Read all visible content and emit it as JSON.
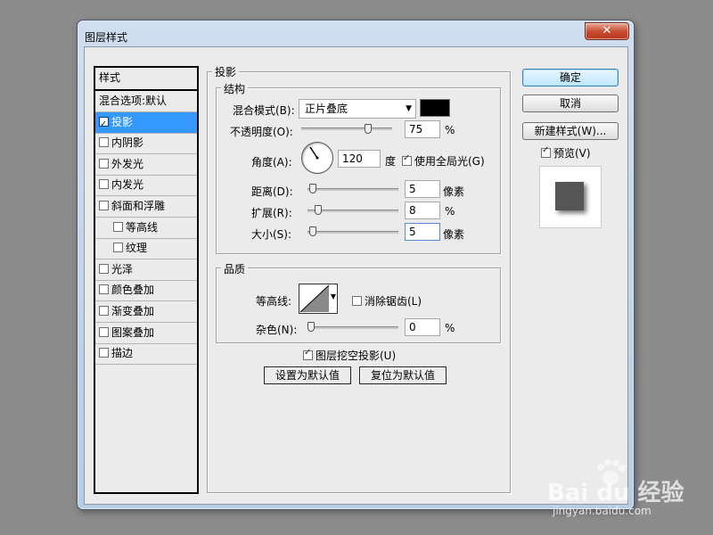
{
  "window": {
    "title": "图层样式",
    "close_glyph": "✕"
  },
  "style_list": {
    "header": "样式",
    "items": [
      {
        "label": "混合选项:默认",
        "checkbox": false,
        "checked": false,
        "indent": false,
        "selected": false
      },
      {
        "label": "投影",
        "checkbox": true,
        "checked": true,
        "indent": false,
        "selected": true
      },
      {
        "label": "内阴影",
        "checkbox": true,
        "checked": false,
        "indent": false,
        "selected": false
      },
      {
        "label": "外发光",
        "checkbox": true,
        "checked": false,
        "indent": false,
        "selected": false
      },
      {
        "label": "内发光",
        "checkbox": true,
        "checked": false,
        "indent": false,
        "selected": false
      },
      {
        "label": "斜面和浮雕",
        "checkbox": true,
        "checked": false,
        "indent": false,
        "selected": false
      },
      {
        "label": "等高线",
        "checkbox": true,
        "checked": false,
        "indent": true,
        "selected": false
      },
      {
        "label": "纹理",
        "checkbox": true,
        "checked": false,
        "indent": true,
        "selected": false
      },
      {
        "label": "光泽",
        "checkbox": true,
        "checked": false,
        "indent": false,
        "selected": false
      },
      {
        "label": "颜色叠加",
        "checkbox": true,
        "checked": false,
        "indent": false,
        "selected": false
      },
      {
        "label": "渐变叠加",
        "checkbox": true,
        "checked": false,
        "indent": false,
        "selected": false
      },
      {
        "label": "图案叠加",
        "checkbox": true,
        "checked": false,
        "indent": false,
        "selected": false
      },
      {
        "label": "描边",
        "checkbox": true,
        "checked": false,
        "indent": false,
        "selected": false
      }
    ]
  },
  "drop_shadow": {
    "section_title": "投影",
    "structure": {
      "title": "结构",
      "blend_mode_label": "混合模式(B):",
      "blend_mode_value": "正片叠底",
      "color": "#000000",
      "opacity_label": "不透明度(O):",
      "opacity_value": "75",
      "opacity_unit": "%",
      "opacity_level": 0.75,
      "angle_label": "角度(A):",
      "angle_value": "120",
      "angle_unit": "度",
      "global_light_label": "使用全局光(G)",
      "global_light_checked": true,
      "distance_label": "距离(D):",
      "distance_value": "5",
      "distance_unit": "像素",
      "distance_level": 0.02,
      "spread_label": "扩展(R):",
      "spread_value": "8",
      "spread_unit": "%",
      "spread_level": 0.08,
      "size_label": "大小(S):",
      "size_value": "5",
      "size_unit": "像素",
      "size_level": 0.02
    },
    "quality": {
      "title": "品质",
      "contour_label": "等高线:",
      "antialias_label": "消除锯齿(L)",
      "antialias_checked": false,
      "noise_label": "杂色(N):",
      "noise_value": "0",
      "noise_unit": "%",
      "noise_level": 0.0
    },
    "knockout_label": "图层挖空投影(U)",
    "knockout_checked": true,
    "make_default_button": "设置为默认值",
    "reset_default_button": "复位为默认值"
  },
  "buttons": {
    "ok": "确定",
    "cancel": "取消",
    "new_style": "新建样式(W)...",
    "preview_label": "预览(V)",
    "preview_checked": true
  },
  "watermark": {
    "logo": "Bai du 经验",
    "url": "jingyan.baidu.com"
  }
}
